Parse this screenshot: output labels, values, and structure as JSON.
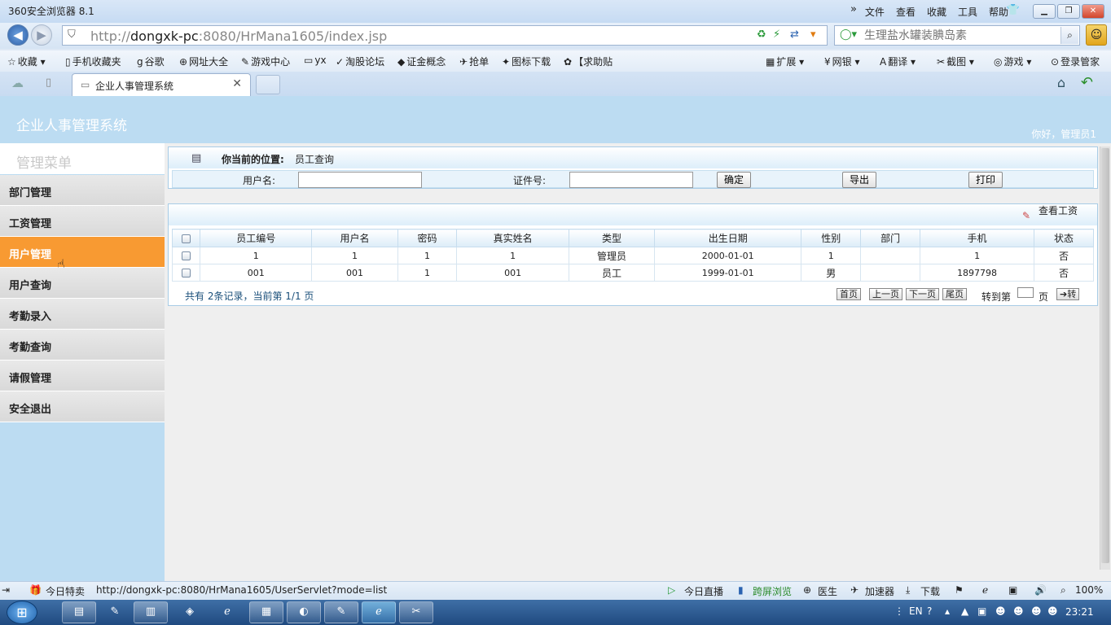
{
  "browser": {
    "title": "360安全浏览器 8.1",
    "menus": [
      "文件",
      "查看",
      "收藏",
      "工具",
      "帮助"
    ],
    "url_prefix": "http://",
    "url_host": "dongxk-pc",
    "url_rest": ":8080/HrMana1605/index.jsp",
    "search_placeholder": "生理盐水罐装腆岛素",
    "favorites": [
      {
        "icon": "☆",
        "label": "收藏"
      },
      {
        "icon": "▯",
        "label": "手机收藏夹"
      },
      {
        "icon": "g",
        "label": "谷歌"
      },
      {
        "icon": "⊕",
        "label": "网址大全"
      },
      {
        "icon": "✎",
        "label": "游戏中心"
      },
      {
        "icon": "▭",
        "label": "yx"
      },
      {
        "icon": "✓",
        "label": "淘股论坛"
      },
      {
        "icon": "◆",
        "label": "证金概念"
      },
      {
        "icon": "✈",
        "label": "抢单"
      },
      {
        "icon": "✦",
        "label": "图标下载"
      },
      {
        "icon": "✿",
        "label": "【求助贴"
      }
    ],
    "toolbar_right": [
      {
        "icon": "▦",
        "label": "扩展"
      },
      {
        "icon": "¥",
        "label": "网银"
      },
      {
        "icon": "A",
        "label": "翻译"
      },
      {
        "icon": "✂",
        "label": "截图"
      },
      {
        "icon": "◎",
        "label": "游戏"
      },
      {
        "icon": "⊙",
        "label": "登录管家"
      }
    ],
    "tab_label": "企业人事管理系统",
    "status_url": "http://dongxk-pc:8080/HrMana1605/UserServlet?mode=list",
    "status_left": "今日特卖",
    "status_items": [
      "今日直播",
      "跨屏浏览",
      "医生",
      "加速器",
      "下载"
    ],
    "zoom": "100%"
  },
  "app": {
    "title": "企业人事管理系统",
    "greeting": "你好，管理员1",
    "menu_title": "管理菜单",
    "menu": [
      {
        "label": "部门管理",
        "active": false
      },
      {
        "label": "工资管理",
        "active": false
      },
      {
        "label": "用户管理",
        "active": true
      },
      {
        "label": "用户查询",
        "active": false
      },
      {
        "label": "考勤录入",
        "active": false
      },
      {
        "label": "考勤查询",
        "active": false
      },
      {
        "label": "请假管理",
        "active": false
      },
      {
        "label": "安全退出",
        "active": false
      }
    ],
    "location_label": "你当前的位置:",
    "location_value": "员工查询",
    "search": {
      "username_label": "用户名:",
      "id_label": "证件号:",
      "confirm": "确定",
      "export": "导出",
      "print": "打印"
    },
    "view_salary": "查看工资",
    "table": {
      "headers": [
        "员工编号",
        "用户名",
        "密码",
        "真实姓名",
        "类型",
        "出生日期",
        "性别",
        "部门",
        "手机",
        "状态"
      ],
      "rows": [
        [
          "1",
          "1",
          "1",
          "1",
          "管理员",
          "2000-01-01",
          "1",
          "",
          "1",
          "否"
        ],
        [
          "001",
          "001",
          "1",
          "001",
          "员工",
          "1999-01-01",
          "男",
          "",
          "1897798",
          "否"
        ]
      ]
    },
    "pager": {
      "summary": "共有 2条记录，当前第 1/1 页",
      "first": "首页",
      "prev": "上一页",
      "next": "下一页",
      "last": "尾页",
      "goto_label": "转到第",
      "page_unit": "页",
      "go": "➔转"
    }
  },
  "taskbar": {
    "lang": "EN",
    "clock": "23:21"
  }
}
